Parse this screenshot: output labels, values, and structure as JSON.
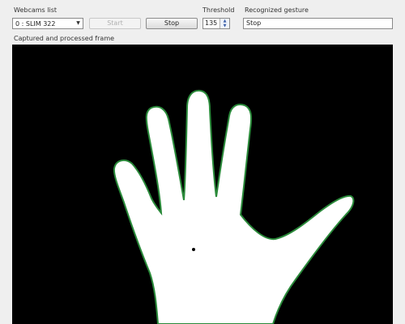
{
  "toolbar": {
    "webcam_list_label": "Webcams list",
    "webcam_selected": "0 : SLIM 322",
    "start_label": "Start",
    "stop_label": "Stop",
    "threshold_label": "Threshold",
    "threshold_value": "135",
    "recognized_label": "Recognized gesture",
    "recognized_value": "Stop"
  },
  "frame": {
    "label": "Captured and processed frame"
  },
  "icons": {
    "dropdown": "chevron-down-icon",
    "spin_up": "spin-up-icon",
    "spin_down": "spin-down-icon"
  },
  "colors": {
    "frame_background": "#000000",
    "hand_fill": "#ffffff",
    "hand_outline": "#2a8a3a"
  }
}
